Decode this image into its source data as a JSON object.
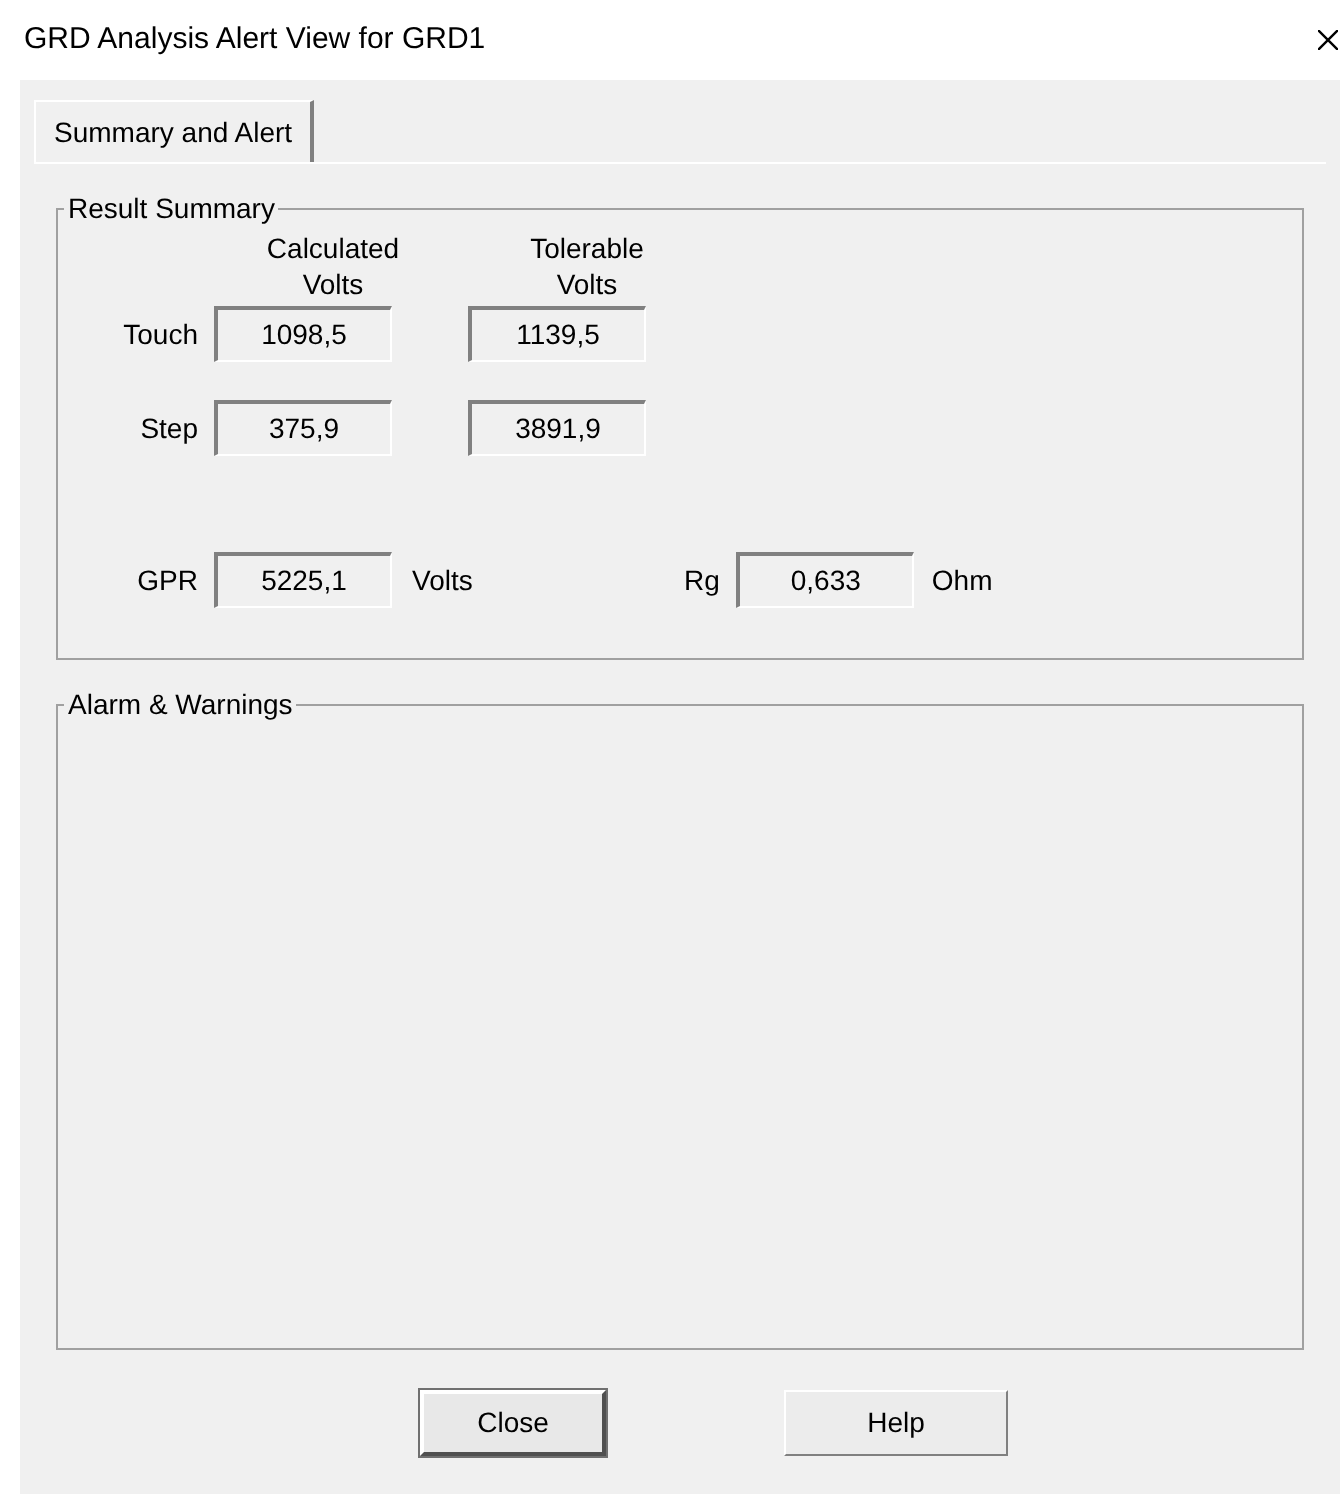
{
  "window": {
    "title": "GRD Analysis Alert View for GRD1"
  },
  "tabs": [
    {
      "label": "Summary and Alert",
      "selected": true
    }
  ],
  "result_summary": {
    "title": "Result Summary",
    "columns": [
      "Calculated\nVolts",
      "Tolerable\nVolts"
    ],
    "rows": [
      {
        "label": "Touch",
        "values": [
          "1098,5",
          "1139,5"
        ]
      },
      {
        "label": "Step",
        "values": [
          "375,9",
          "3891,9"
        ]
      }
    ],
    "gpr": {
      "label": "GPR",
      "value": "5225,1",
      "unit": "Volts"
    },
    "rg": {
      "label": "Rg",
      "value": "0,633",
      "unit": "Ohm"
    }
  },
  "alarms": {
    "title": "Alarm & Warnings"
  },
  "buttons": [
    {
      "label": "Close",
      "default": true
    },
    {
      "label": "Help",
      "default": false
    }
  ]
}
